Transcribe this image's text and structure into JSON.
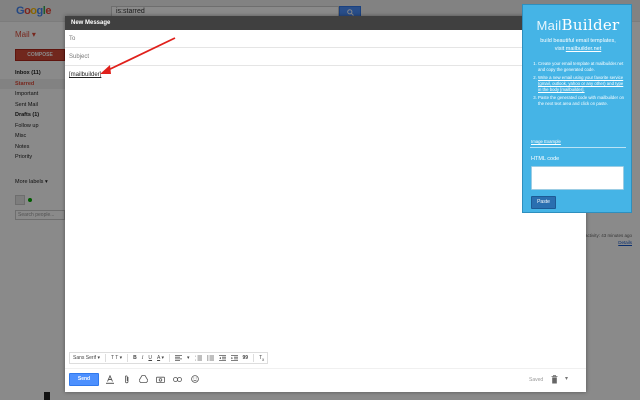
{
  "gmail": {
    "logo_letters": [
      "G",
      "o",
      "o",
      "g",
      "l",
      "e"
    ],
    "search_value": "is:starred",
    "mail_label": "Mail ▾",
    "compose_label": "COMPOSE",
    "nav": [
      {
        "label": "Inbox (11)",
        "style": "bold"
      },
      {
        "label": "Starred",
        "style": "red"
      },
      {
        "label": "Important",
        "style": ""
      },
      {
        "label": "Sent Mail",
        "style": ""
      },
      {
        "label": "Drafts (1)",
        "style": "bold"
      },
      {
        "label": "Follow up",
        "style": ""
      },
      {
        "label": "Misc",
        "style": ""
      },
      {
        "label": "Notes",
        "style": ""
      },
      {
        "label": "Priority",
        "style": ""
      }
    ],
    "more_labels": "More labels ▾",
    "people_placeholder": "Search people...",
    "activity_text": "t activity: 43 minutes ago",
    "details_link": "Details"
  },
  "compose": {
    "title": "New Message",
    "to_label": "To",
    "subject_label": "Subject",
    "body_text": "[mailbuilder]",
    "format": {
      "font": "Sans Serif",
      "size": "T T",
      "bold": "B",
      "italic": "I",
      "underline": "U",
      "color": "A",
      "quote": "99",
      "clear": "T"
    },
    "send_label": "Send",
    "saved_label": "Saved"
  },
  "mailbuilder": {
    "logo_thin": "Mail",
    "logo_bold": "Builder",
    "tagline_1": "build beautiful email templates,",
    "tagline_2": "visit",
    "tagline_link": "mailbuilder.net",
    "steps": [
      "Create your email template at mailbuilder.net and copy the generated code.",
      "Write a new email using your favorite service (gmail, outlook, yahoo or any other) and type in the body [mailbuilder].",
      "Paste the generated code with mailbuilder on the next text area and click on paste."
    ],
    "image_example": "Image Example",
    "html_label": "HTML code",
    "paste_label": "Paste"
  },
  "colors": {
    "mb_panel": "#45b4e6",
    "send_blue": "#4d90fe",
    "compose_red": "#d14836",
    "arrow_red": "#e0201b"
  }
}
